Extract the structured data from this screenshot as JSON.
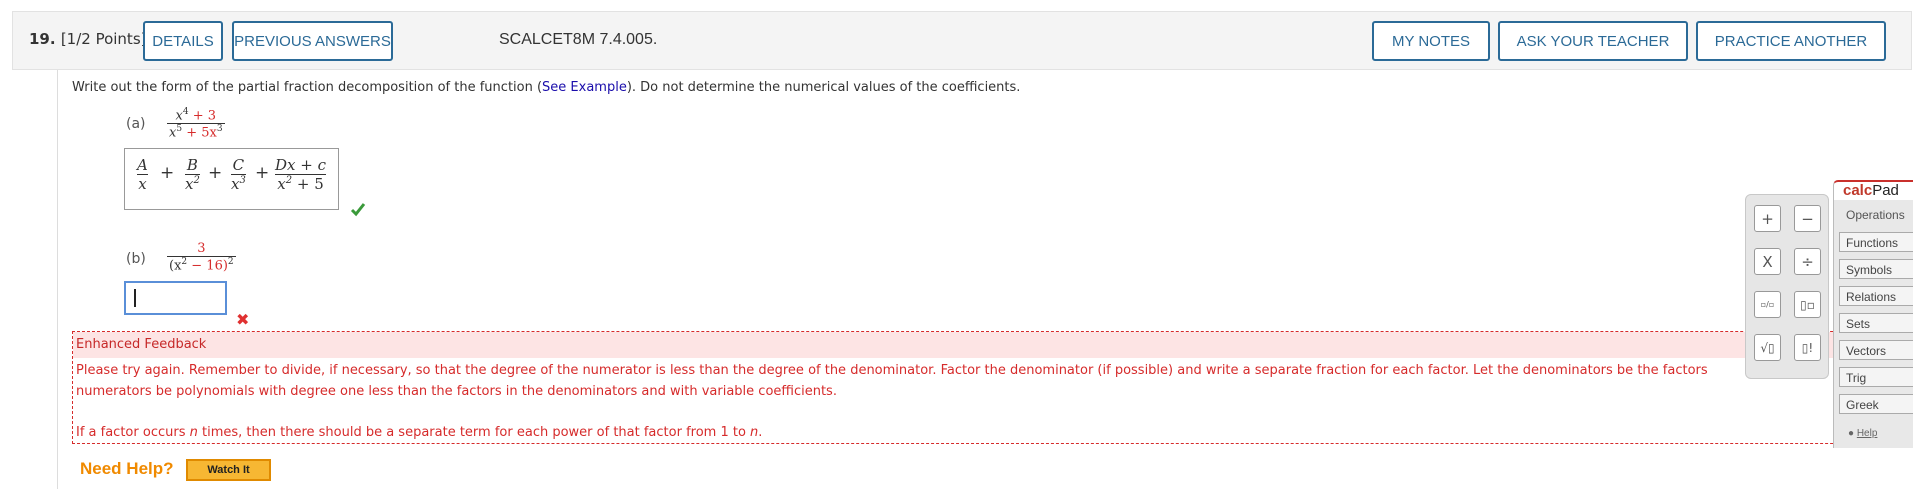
{
  "header": {
    "question_number": "19.",
    "points": "[1/2 Points]",
    "details_label": "DETAILS",
    "previous_answers_label": "PREVIOUS ANSWERS",
    "problem_code": "SCALCET8M 7.4.005.",
    "my_notes_label": "MY NOTES",
    "ask_teacher_label": "ASK YOUR TEACHER",
    "practice_another_label": "PRACTICE ANOTHER"
  },
  "prompt": {
    "before_link": "Write out the form of the partial fraction decomposition of the function (",
    "link": "See Example",
    "after_link": "). Do not determine the numerical values of the coefficients."
  },
  "part_a": {
    "label": "(a)",
    "num_base": "x",
    "num_exp": "4",
    "num_rest": " + 3",
    "den_base1": "x",
    "den_exp1": "5",
    "den_rest": " + 5x",
    "den_exp2": "3",
    "answer": {
      "t1_num": "A",
      "t1_den": "x",
      "t2_num": "B",
      "t2_den": "x",
      "t2_exp": "2",
      "t3_num": "C",
      "t3_den": "x",
      "t3_exp": "3",
      "t4_num": "Dx + c",
      "t4_den": "x",
      "t4_exp": "2",
      "t4_den_rest": " + 5",
      "plus": "+"
    },
    "status_icon": "check-icon"
  },
  "part_b": {
    "label": "(b)",
    "numerator": "3",
    "den_open": "(x",
    "den_exp": "2",
    "den_mid": " − 16)",
    "den_exp2": "2",
    "input_value": "",
    "status_icon": "x-mark-icon"
  },
  "feedback": {
    "title": "Enhanced Feedback",
    "line1": "Please try again. Remember to divide, if necessary, so that the degree of the numerator is less than the degree of the denominator. Factor the denominator (if possible) and write a separate fraction for each factor. Let the denominators be the factors",
    "line2": "numerators be polynomials with degree one less than the factors in the denominators and with variable coefficients.",
    "line3_a": "If a factor occurs ",
    "line3_n": "n",
    "line3_b": " times, then there should be a separate term for each power of that factor from 1 to ",
    "line3_n2": "n",
    "line3_c": "."
  },
  "help": {
    "need_help": "Need Help?",
    "watch_it": "Watch It"
  },
  "calcpad": {
    "title_a": "calc",
    "title_b": "Pad",
    "operations": "Operations",
    "menu": [
      "Functions",
      "Symbols",
      "Relations",
      "Sets",
      "Vectors",
      "Trig",
      "Greek"
    ],
    "help": "Help",
    "keys": [
      "+",
      "−",
      "X",
      "÷",
      "▫/▫",
      "▯▫",
      "√▯",
      "▯!"
    ]
  },
  "colors": {
    "accent_blue": "#2b6a97",
    "error_red": "#d62b2b",
    "help_orange": "#f08a00"
  }
}
